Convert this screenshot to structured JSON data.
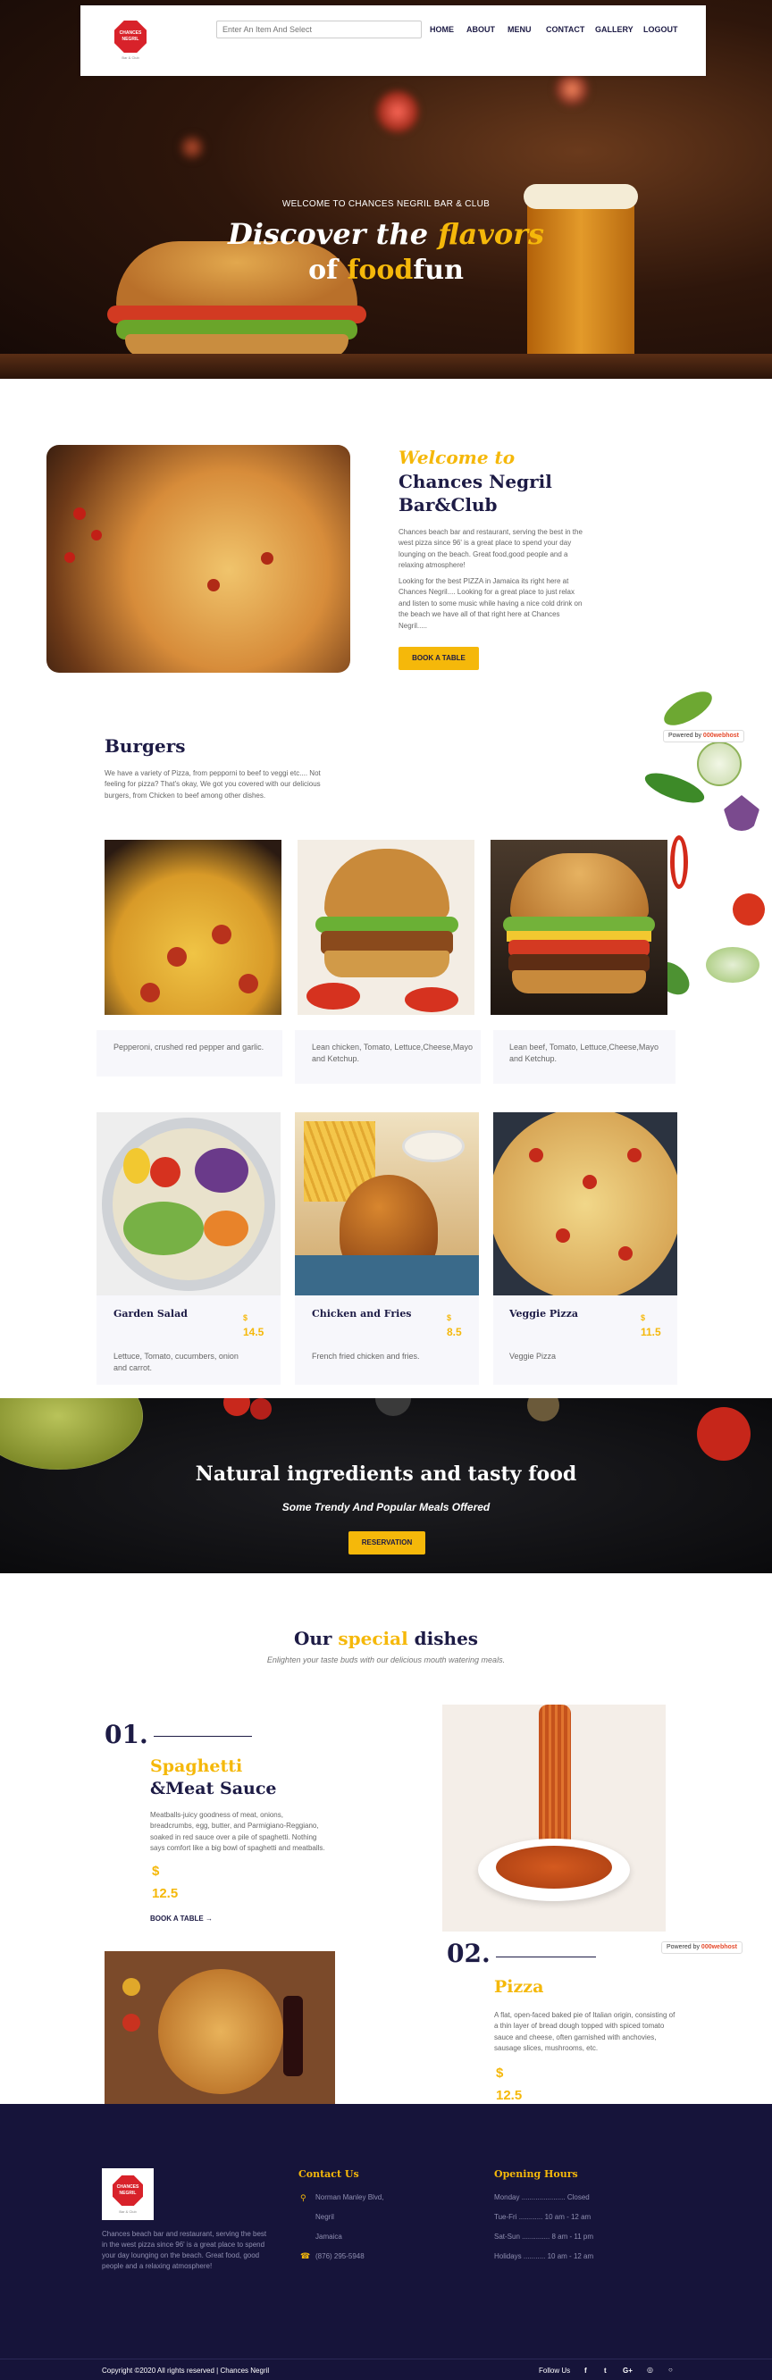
{
  "brand": {
    "logo_line1": "CHANCES",
    "logo_line2": "NEGRIL",
    "logo_tag": "Bar & Club"
  },
  "search": {
    "placeholder": "Enter An Item And Select"
  },
  "nav": [
    "HOME",
    "ABOUT",
    "MENU",
    "CONTACT",
    "GALLERY",
    "LOGOUT"
  ],
  "hero": {
    "kicker": "WELCOME TO CHANCES NEGRIL BAR & CLUB",
    "line1_a": "Discover the ",
    "line1_b": "flavors",
    "line2_a": "of ",
    "line2_b": "food",
    "line2_c": "fun"
  },
  "welcome": {
    "kicker": "Welcome to",
    "title1": "Chances Negril",
    "title2": "Bar&Club",
    "p1": "Chances beach bar and restaurant, serving the best in the west pizza since 96' is a great place to spend your day lounging on the beach. Great food,good people and a relaxing atmosphere!",
    "p2": "Looking for the best PIZZA in Jamaica its right here at Chances Negril.... Looking for a great place to just relax and listen to some music while having a nice cold drink on the beach we have all of that right here at Chances Negril.....",
    "button": "BOOK A TABLE"
  },
  "powered": {
    "text": "Powered by",
    "brand": "000webhost"
  },
  "burgers": {
    "title": "Burgers",
    "desc": "We have a variety of Pizza, from pepporni to beef to veggi etc.... Not feeling for pizza? That's okay, We got you covered with our delicious burgers, from Chicken to beef among other dishes."
  },
  "menu_row1": [
    {
      "desc": "Pepperoni, crushed red pepper and garlic."
    },
    {
      "desc": "Lean chicken, Tomato, Lettuce,Cheese,Mayo and Ketchup."
    },
    {
      "desc": "Lean beef, Tomato, Lettuce,Cheese,Mayo and Ketchup."
    }
  ],
  "menu_row2": [
    {
      "name": "Garden Salad",
      "currency": "$",
      "price": "14.5",
      "desc": "Lettuce, Tomato, cucumbers, onion and carrot."
    },
    {
      "name": "Chicken and Fries",
      "currency": "$",
      "price": "8.5",
      "desc": "French fried chicken and fries."
    },
    {
      "name": "Veggie Pizza",
      "currency": "$",
      "price": "11.5",
      "desc": "Veggie Pizza"
    }
  ],
  "banner": {
    "title": "Natural ingredients and tasty food",
    "subtitle": "Some Trendy And Popular Meals Offered",
    "button": "RESERVATION"
  },
  "special": {
    "title_a": "Our ",
    "title_b": "special",
    "title_c": " dishes",
    "subtitle": "Enlighten your taste buds with our delicious mouth watering meals."
  },
  "dish1": {
    "num": "01.",
    "name1": "Spaghetti",
    "name2": "&Meat Sauce",
    "desc": "Meatballs-juicy goodness of meat, onions, breadcrumbs, egg, butter, and Parmigiano-Reggiano, soaked in red sauce over a pile of spaghetti. Nothing says comfort like a big bowl of spaghetti and meatballs.",
    "currency": "$",
    "price": "12.5",
    "link": "BOOK A TABLE"
  },
  "dish2": {
    "num": "02.",
    "name": "Pizza",
    "desc": "A flat, open-faced baked pie of Italian origin, consisting of a thin layer of bread dough topped with spiced tomato sauce and cheese, often garnished with anchovies, sausage slices, mushrooms, etc.",
    "currency": "$",
    "price": "12.5"
  },
  "footer": {
    "about": "Chances beach bar and restaurant, serving the best in the west pizza since 96' is a great place to spend your day lounging on the beach. Great food, good people and a relaxing atmosphere!",
    "contact_title": "Contact Us",
    "contact": [
      "Norman Manley Blvd,",
      "Negril",
      "Jamaica",
      "(876) 295-5948"
    ],
    "hours_title": "Opening Hours",
    "hours": [
      {
        "day": "Monday",
        "dots": " ......................",
        "time": "Closed"
      },
      {
        "day": "Tue-Fri",
        "dots": " ............",
        "time": "10 am - 12 am"
      },
      {
        "day": "Sat-Sun",
        "dots": " ..............",
        "time": "8 am - 11 pm"
      },
      {
        "day": "Holidays",
        "dots": " ...........",
        "time": "10 am - 12 am"
      }
    ],
    "copyright": "Copyright ©2020 All rights reserved | Chances Negril",
    "follow": "Follow Us",
    "social": [
      "f",
      "t",
      "G+",
      "◎",
      "○"
    ]
  },
  "colors": {
    "accent": "#f5b80a",
    "navy": "#1d1b45",
    "footer_bg": "#16143a"
  }
}
